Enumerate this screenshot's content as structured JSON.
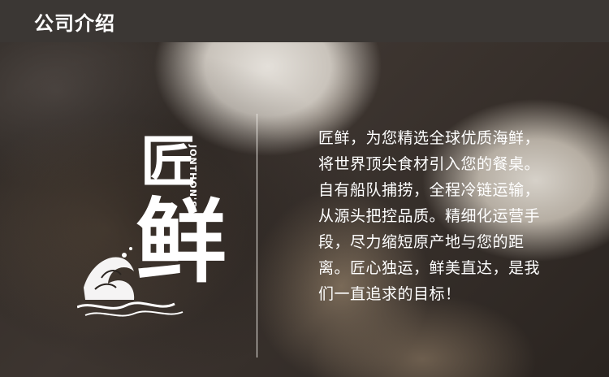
{
  "header": {
    "title": "公司介绍"
  },
  "logo": {
    "brand_cn_1": "匠",
    "brand_cn_2": "鲜",
    "brand_en": "JONTHON'S"
  },
  "intro": {
    "lines": [
      "匠鲜，为您精选全球优质海鲜，",
      "将世界顶尖食材引入您的餐桌。",
      "自有船队捕捞，全程冷链运输，",
      "从源头把控品质。精细化运营手",
      "段，尽力缩短原产地与您的距",
      "离。匠心独运，鲜美直达，是我",
      "们一直追求的目标！"
    ]
  }
}
